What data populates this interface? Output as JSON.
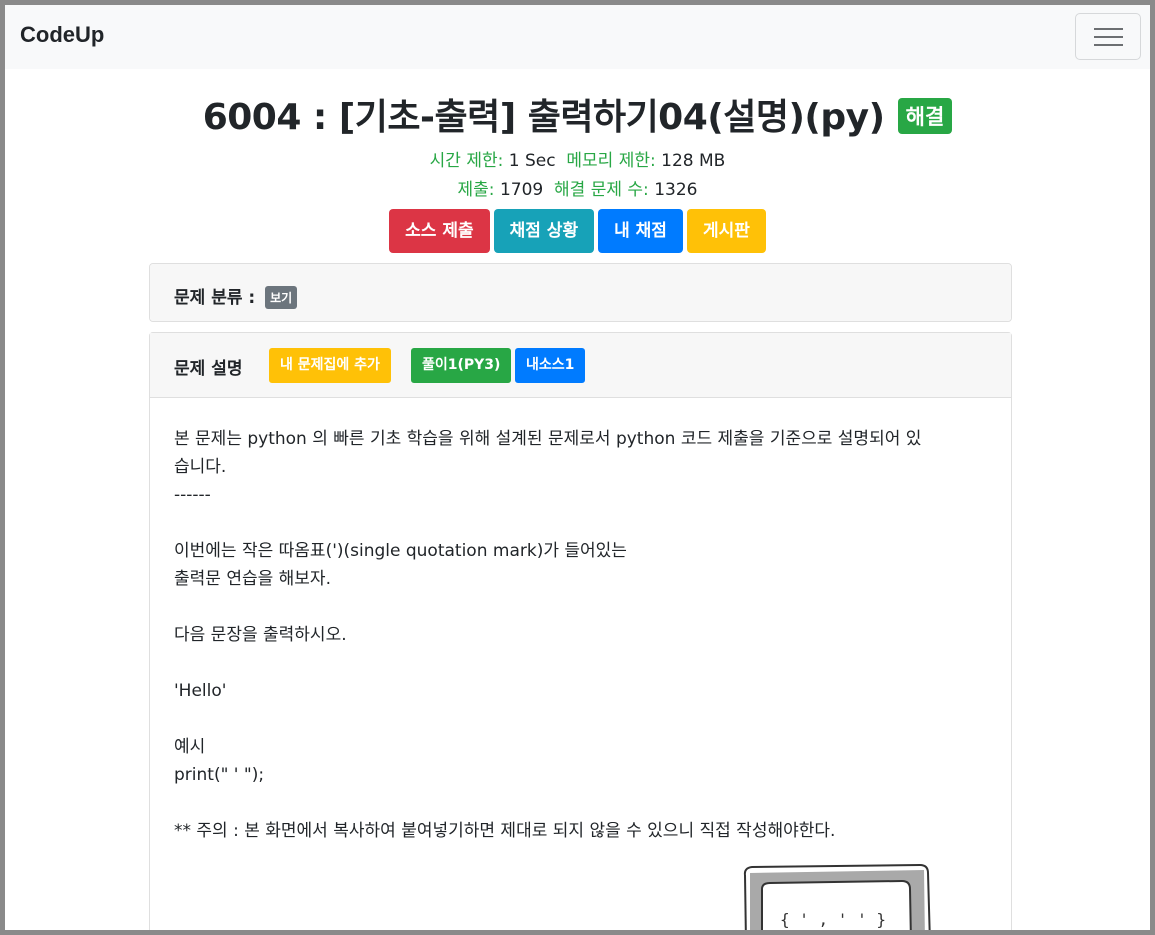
{
  "navbar": {
    "brand": "CodeUp"
  },
  "problem": {
    "title": "6004 : [기초-출력] 출력하기04(설명)(py)",
    "status_badge": "해결",
    "time_limit_label": "시간 제한:",
    "time_limit_value": "1 Sec",
    "memory_limit_label": "메모리 제한:",
    "memory_limit_value": "128 MB",
    "submissions_label": "제출:",
    "submissions_value": "1709",
    "solved_label": "해결 문제 수:",
    "solved_value": "1326"
  },
  "actions": {
    "submit": "소스 제출",
    "status": "채점 상황",
    "my_grade": "내 채점",
    "board": "게시판"
  },
  "category": {
    "label": "문제 분류 :",
    "view_badge": "보기"
  },
  "description": {
    "label": "문제 설명",
    "add_to_set": "내 문제집에 추가",
    "solution": "풀이1(PY3)",
    "my_source": "내소스1",
    "lines": [
      "본 문제는 python 의 빠른 기초 학습을 위해 설계된 문제로서 python 코드 제출을 기준으로 설명되어 있",
      "습니다.",
      "------",
      "",
      "이번에는 작은 따옴표(')(single quotation mark)가 들어있는",
      "출력문 연습을 해보자.",
      "",
      "다음 문장을 출력하시오.",
      "",
      "'Hello'",
      "",
      "예시",
      "print(\" ' \");",
      "",
      "** 주의 : 본 화면에서 복사하여 붙여넣기하면 제대로 되지 않을 수 있으니 직접 작성해야한다."
    ]
  },
  "colors": {
    "success": "#28a745",
    "danger": "#dc3545",
    "info": "#17a2b8",
    "primary": "#007bff",
    "warning": "#ffc107",
    "secondary": "#6c757d"
  }
}
